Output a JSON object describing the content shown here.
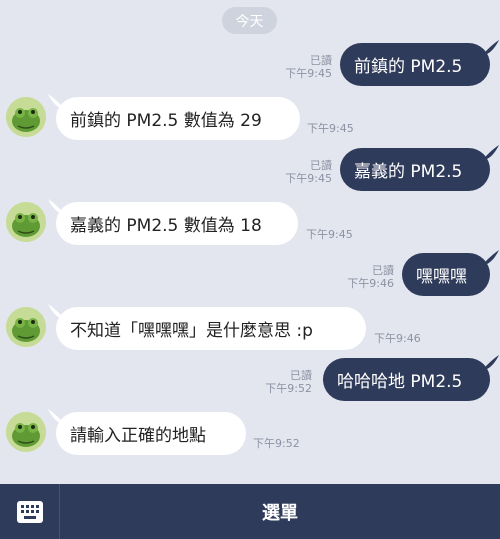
{
  "date_label": "今天",
  "messages": [
    {
      "side": "out",
      "text": "前鎮的 PM2.5",
      "read": "已讀",
      "time": "下午9:45"
    },
    {
      "side": "in",
      "text": "前鎮的 PM2.5 數值為 29",
      "time": "下午9:45"
    },
    {
      "side": "out",
      "text": "嘉義的 PM2.5",
      "read": "已讀",
      "time": "下午9:45"
    },
    {
      "side": "in",
      "text": "嘉義的 PM2.5 數值為 18",
      "time": "下午9:45"
    },
    {
      "side": "out",
      "text": "嘿嘿嘿",
      "read": "已讀",
      "time": "下午9:46"
    },
    {
      "side": "in",
      "text": "不知道「嘿嘿嘿」是什麼意思 :p",
      "time": "下午9:46"
    },
    {
      "side": "out",
      "text": "哈哈哈地 PM2.5",
      "read": "已讀",
      "time": "下午9:52"
    },
    {
      "side": "in",
      "text": "請輸入正確的地點",
      "time": "下午9:52"
    }
  ],
  "bottom_bar": {
    "keyboard_icon": "keyboard-icon",
    "menu_label": "選單"
  },
  "colors": {
    "background": "#e4e6ef",
    "outgoing_bubble": "#2f3b5a",
    "incoming_bubble": "#ffffff",
    "bottom_bar": "#2f3b5a"
  }
}
